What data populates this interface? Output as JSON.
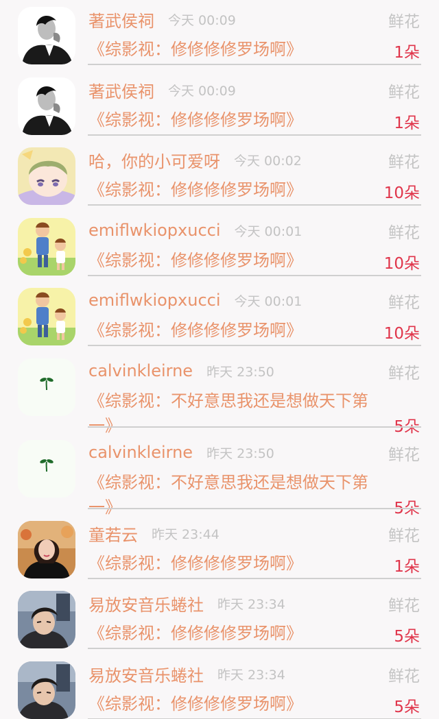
{
  "gift_label": "鲜花",
  "items": [
    {
      "avatar": "bw-man-avatar",
      "name": "著武侯祠",
      "time": "今天 00:09",
      "title": "《综影视：修修修修罗场啊》",
      "count": "1朵"
    },
    {
      "avatar": "bw-man-avatar",
      "name": "著武侯祠",
      "time": "今天 00:09",
      "title": "《综影视：修修修修罗场啊》",
      "count": "1朵"
    },
    {
      "avatar": "anime-child-avatar",
      "name": "哈，你的小可爱呀",
      "time": "今天 00:02",
      "title": "《综影视：修修修修罗场啊》",
      "count": "10朵"
    },
    {
      "avatar": "cartoon-kids-avatar",
      "name": "emiflwkiopxucci",
      "time": "今天 00:01",
      "title": "《综影视：修修修修罗场啊》",
      "count": "10朵"
    },
    {
      "avatar": "cartoon-kids-avatar",
      "name": "emiflwkiopxucci",
      "time": "今天 00:01",
      "title": "《综影视：修修修修罗场啊》",
      "count": "10朵"
    },
    {
      "avatar": "sprout-avatar",
      "name": "calvinkleirne",
      "time": "昨天 23:50",
      "title": "《综影视：不好意思我还是想做天下第一》",
      "count": "5朵"
    },
    {
      "avatar": "sprout-avatar",
      "name": "calvinkleirne",
      "time": "昨天 23:50",
      "title": "《综影视：不好意思我还是想做天下第一》",
      "count": "5朵"
    },
    {
      "avatar": "woman-avatar",
      "name": "童若云",
      "time": "昨天 23:44",
      "title": "《综影视：修修修修罗场啊》",
      "count": "1朵"
    },
    {
      "avatar": "young-man-avatar",
      "name": "易放安音乐蜷社",
      "time": "昨天 23:34",
      "title": "《综影视：修修修修罗场啊》",
      "count": "5朵"
    },
    {
      "avatar": "young-man-avatar",
      "name": "易放安音乐蜷社",
      "time": "昨天 23:34",
      "title": "《综影视：修修修修罗场啊》",
      "count": "5朵"
    }
  ]
}
